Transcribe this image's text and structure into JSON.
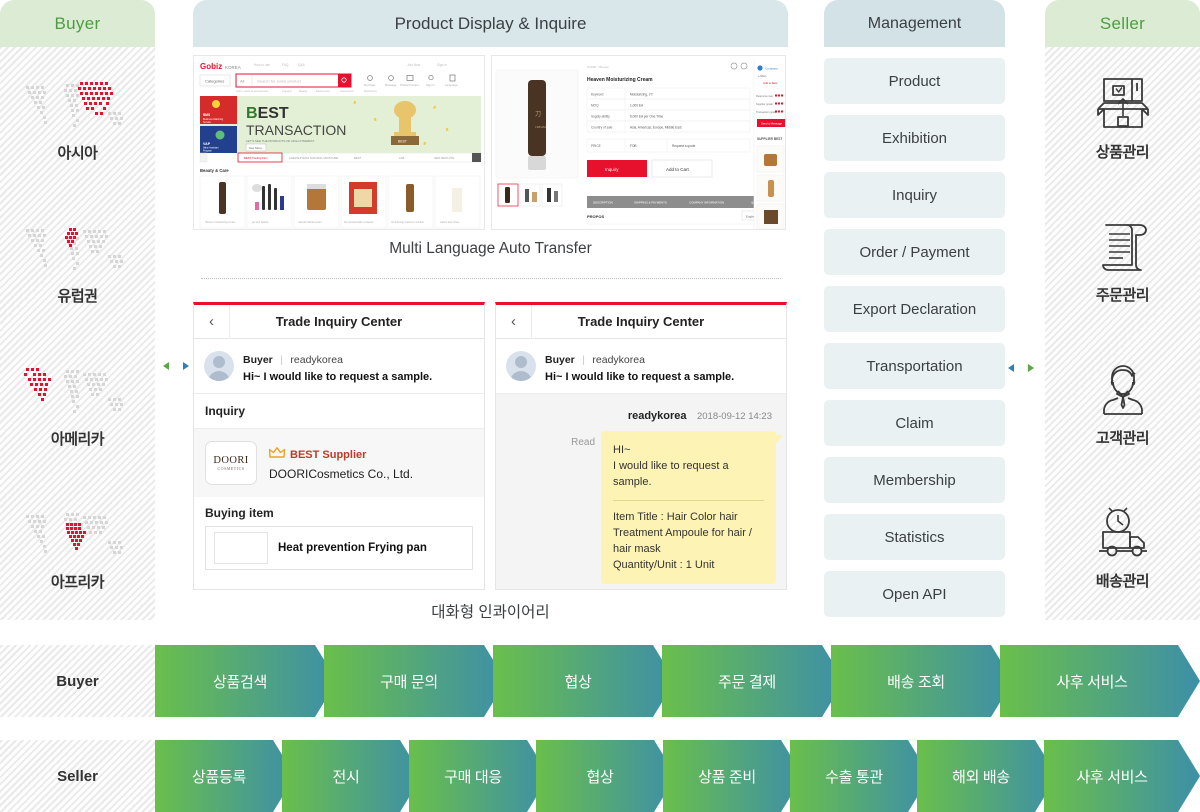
{
  "buyer_column": {
    "header": "Buyer",
    "regions": [
      {
        "label": "아시아",
        "icon": "world-map-asia-icon"
      },
      {
        "label": "유럽권",
        "icon": "world-map-europe-icon"
      },
      {
        "label": "아메리카",
        "icon": "world-map-america-icon"
      },
      {
        "label": "아프리카",
        "icon": "world-map-africa-icon"
      }
    ]
  },
  "seller_column": {
    "header": "Seller",
    "items": [
      {
        "label": "상품관리",
        "icon": "open-box-icon"
      },
      {
        "label": "주문관리",
        "icon": "scroll-document-icon"
      },
      {
        "label": "고객관리",
        "icon": "customer-person-icon"
      },
      {
        "label": "배송관리",
        "icon": "delivery-truck-icon"
      }
    ]
  },
  "center_column": {
    "header": "Product Display & Inquire",
    "caption_top": "Multi Language Auto Transfer",
    "caption_bottom": "대화형 인콰이어리",
    "storefront_shot": {
      "logo": "Gobiz KOREA",
      "search_placeholder": "Search for some product",
      "categories_label": "Categories",
      "banner_line1": "BEST",
      "banner_line2": "TRANSACTION",
      "banner_sub": "LET'S SEE THE PRODUCTS OF HIGH INTEREST",
      "banner_button": "See More",
      "section_title": "Beauty & Care",
      "side_cards": [
        "BMS",
        "VAP"
      ]
    },
    "product_shot": {
      "product_name": "Heaven Moisturizing Cream",
      "spec_rows": [
        [
          "Keyword",
          "Moisturizing, YY"
        ],
        [
          "MOQ",
          "1,000 EA"
        ],
        [
          "Supply ability",
          "6,000 EA per One Time"
        ],
        [
          "Country of sale",
          "Asia, Americas, Europe, Middle East"
        ],
        [
          "PRICE",
          "FOB"
        ]
      ],
      "inquiry_button": "Inquiry",
      "cart_button": "Add to Cart",
      "tabs": [
        "DESCRIPTION",
        "SHIPPING & PAYMENTS",
        "COMPANY INFORMATION",
        "Q&A"
      ],
      "propos_label": "PROPOS",
      "language_select": "English",
      "supplier_best_label": "SUPPLIER BEST",
      "send_message_button": "Send a Message",
      "rating_rows": [
        "Response rate",
        "Supplier grade",
        "Transaction grade"
      ]
    },
    "chat_left": {
      "back_icon": "chevron-left-icon",
      "title": "Trade Inquiry Center",
      "user_role": "Buyer",
      "user_sep": "|",
      "user_id": "readykorea",
      "user_message": "Hi~ I would like to request a sample.",
      "section_label": "Inquiry",
      "supplier_logo_main": "DOORI",
      "supplier_logo_sub": "COSMETICS",
      "best_supplier_badge": "BEST Supplier",
      "crown_icon": "crown-icon",
      "supplier_name": "DOORICosmetics Co., Ltd.",
      "buying_item_label": "Buying item",
      "buying_item_name": "Heat prevention Frying pan"
    },
    "chat_right": {
      "back_icon": "chevron-left-icon",
      "title": "Trade Inquiry Center",
      "user_role": "Buyer",
      "user_sep": "|",
      "user_id": "readykorea",
      "user_message": "Hi~ I would like to request a sample.",
      "bubble_author": "readykorea",
      "bubble_time": "2018-09-12 14:23",
      "read_status": "Read",
      "bubble_greeting": "HI~",
      "bubble_body": "I would like to request a sample.",
      "bubble_item_title": "Item Title : Hair Color hair Treatment Ampoule for hair / hair mask",
      "bubble_quantity": "Quantity/Unit : 1 Unit"
    }
  },
  "management_column": {
    "header": "Management",
    "items": [
      "Product",
      "Exhibition",
      "Inquiry",
      "Order / Payment",
      "Export Declaration",
      "Transportation",
      "Claim",
      "Membership",
      "Statistics",
      "Open API"
    ]
  },
  "connectors": {
    "left_arrow": "double-arrow-icon",
    "right_arrow": "double-arrow-icon"
  },
  "flow_buyer": {
    "label": "Buyer",
    "steps": [
      "상품검색",
      "구매 문의",
      "협상",
      "주문 결제",
      "배송 조회",
      "사후 서비스"
    ]
  },
  "flow_seller": {
    "label": "Seller",
    "steps": [
      "상품등록",
      "전시",
      "구매 대응",
      "협상",
      "상품 준비",
      "수출 통관",
      "해외 배송",
      "사후 서비스"
    ]
  },
  "colors": {
    "buyer_header_bg": "#dcecd4",
    "buyer_header_text": "#4b9e3f",
    "center_header_bg": "#d9e6ea",
    "management_header_bg": "#d3e2e6",
    "management_item_bg": "#eaf1f3",
    "accent_red": "#e8112d",
    "flow_gradient_start": "#6abf4b",
    "flow_gradient_end": "#3d8fa8",
    "bubble_yellow": "#fdf3b4",
    "map_dot_active": "#e8112d",
    "map_dot_idle": "#d6d6d6"
  }
}
